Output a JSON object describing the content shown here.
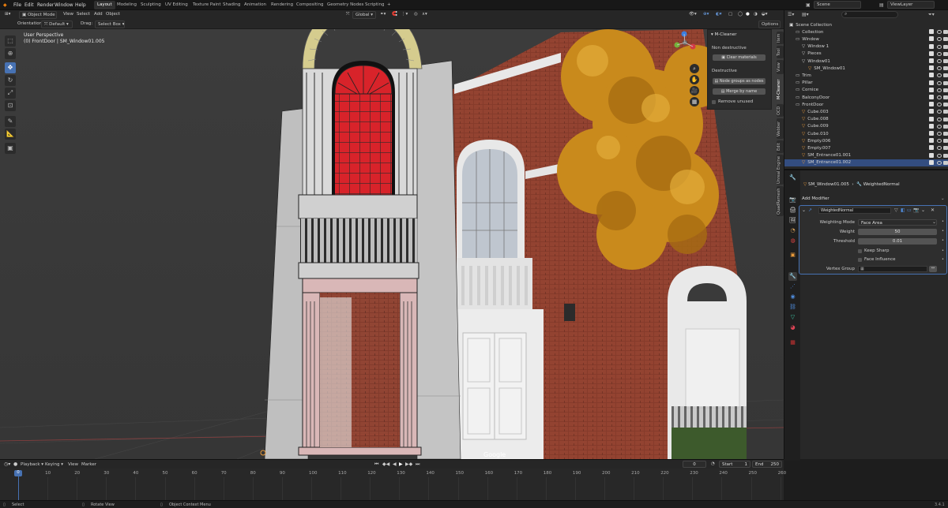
{
  "topbar": {
    "menus": [
      "File",
      "Edit",
      "Render",
      "Window",
      "Help"
    ],
    "workspaces": [
      "Layout",
      "Modeling",
      "Sculpting",
      "UV Editing",
      "Texture Paint",
      "Shading",
      "Animation",
      "Rendering",
      "Compositing",
      "Geometry Nodes",
      "Scripting"
    ],
    "active_workspace": "Layout",
    "add_tab": "+",
    "scene": "Scene",
    "view_layer": "ViewLayer"
  },
  "viewport_header": {
    "mode": "Object Mode",
    "menus": [
      "View",
      "Select",
      "Add",
      "Object"
    ],
    "transform": "Global",
    "options": "Options"
  },
  "viewport_header2": {
    "orientation_label": "Orientation:",
    "orientation_value": "Default",
    "drag_label": "Drag:",
    "drag_value": "Select Box"
  },
  "viewport": {
    "perspective": "User Perspective",
    "object_info": "(0) FrontDoor | SM_Window01.005",
    "watermark": "Google"
  },
  "npanel": {
    "title": "M-Cleaner",
    "non_destructive": "Non destructive",
    "clear_materials": "Clear materials",
    "destructive": "Destructive",
    "node_groups": "Node groups as nodes",
    "merge_by_name": "Merge by name",
    "remove_unused": "Remove unused"
  },
  "sidebar_tabs": [
    "Item",
    "Tool",
    "View",
    "M-Cleaner",
    "OCD",
    "Webber",
    "Edit",
    "Unreal Engine",
    "QuadRemesh"
  ],
  "outliner": {
    "search_placeholder": "",
    "items": [
      {
        "name": "Scene Collection",
        "indent": 0
      },
      {
        "name": "Collection",
        "indent": 1
      },
      {
        "name": "Window",
        "indent": 1
      },
      {
        "name": "Window 1",
        "indent": 2
      },
      {
        "name": "Pieces",
        "indent": 2
      },
      {
        "name": "Window01",
        "indent": 2
      },
      {
        "name": "SM_Window01",
        "indent": 3
      },
      {
        "name": "Trim",
        "indent": 1
      },
      {
        "name": "Pillar",
        "indent": 1
      },
      {
        "name": "Cornice",
        "indent": 1
      },
      {
        "name": "BalconyDoor",
        "indent": 1
      },
      {
        "name": "FrontDoor",
        "indent": 1
      },
      {
        "name": "Cube.003",
        "indent": 2
      },
      {
        "name": "Cube.008",
        "indent": 2
      },
      {
        "name": "Cube.009",
        "indent": 2
      },
      {
        "name": "Cube.010",
        "indent": 2
      },
      {
        "name": "Empty.006",
        "indent": 2
      },
      {
        "name": "Empty.007",
        "indent": 2
      },
      {
        "name": "SM_Entrance01.001",
        "indent": 2
      },
      {
        "name": "SM_Entrance01.002",
        "indent": 2
      }
    ]
  },
  "properties": {
    "breadcrumb_object": "SM_Window01.005",
    "breadcrumb_modifier": "WeightedNormal",
    "add_modifier": "Add Modifier",
    "modifier_name": "WeightedNormal",
    "weighting_mode_label": "Weighting Mode",
    "weighting_mode_value": "Face Area",
    "weight_label": "Weight",
    "weight_value": "50",
    "threshold_label": "Threshold",
    "threshold_value": "0.01",
    "keep_sharp": "Keep Sharp",
    "face_influence": "Face Influence",
    "vertex_group_label": "Vertex Group"
  },
  "timeline": {
    "menus": [
      "Playback",
      "Keying",
      "View",
      "Marker"
    ],
    "current_frame": "0",
    "start_label": "Start",
    "start_value": "1",
    "end_label": "End",
    "end_value": "250",
    "ticks": [
      "0",
      "10",
      "20",
      "30",
      "40",
      "50",
      "60",
      "70",
      "80",
      "90",
      "100",
      "110",
      "120",
      "130",
      "140",
      "150",
      "160",
      "170",
      "180",
      "190",
      "200",
      "210",
      "220",
      "230",
      "240",
      "250",
      "260"
    ]
  },
  "statusbar": {
    "select": "Select",
    "rotate": "Rotate View",
    "context": "Object Context Menu",
    "version": "3.4.1"
  },
  "colors": {
    "accent": "#4772b3",
    "viewport_bg": "#393939",
    "selection_orange": "#e89a3a",
    "window_red": "#d8232a"
  }
}
